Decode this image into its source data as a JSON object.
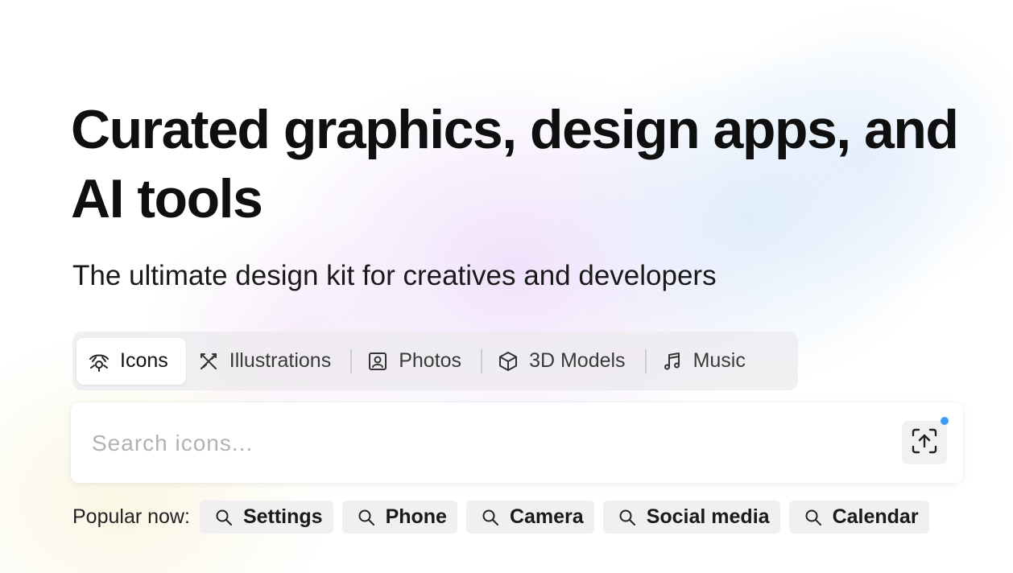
{
  "hero": {
    "title": "Curated graphics, design apps, and AI tools",
    "subtitle": "The ultimate design kit for creatives and developers"
  },
  "tabs": [
    {
      "label": "Icons",
      "icon": "icons-tab-icon",
      "active": true
    },
    {
      "label": "Illustrations",
      "icon": "illustrations-tab-icon",
      "active": false
    },
    {
      "label": "Photos",
      "icon": "photos-tab-icon",
      "active": false
    },
    {
      "label": "3D Models",
      "icon": "cube-icon",
      "active": false
    },
    {
      "label": "Music",
      "icon": "music-note-icon",
      "active": false
    }
  ],
  "search": {
    "placeholder": "Search icons...",
    "value": "",
    "upload_icon": "upload-image-icon",
    "notification_color": "#3b9cf5"
  },
  "popular": {
    "label": "Popular now:",
    "items": [
      "Settings",
      "Phone",
      "Camera",
      "Social media",
      "Calendar"
    ]
  }
}
